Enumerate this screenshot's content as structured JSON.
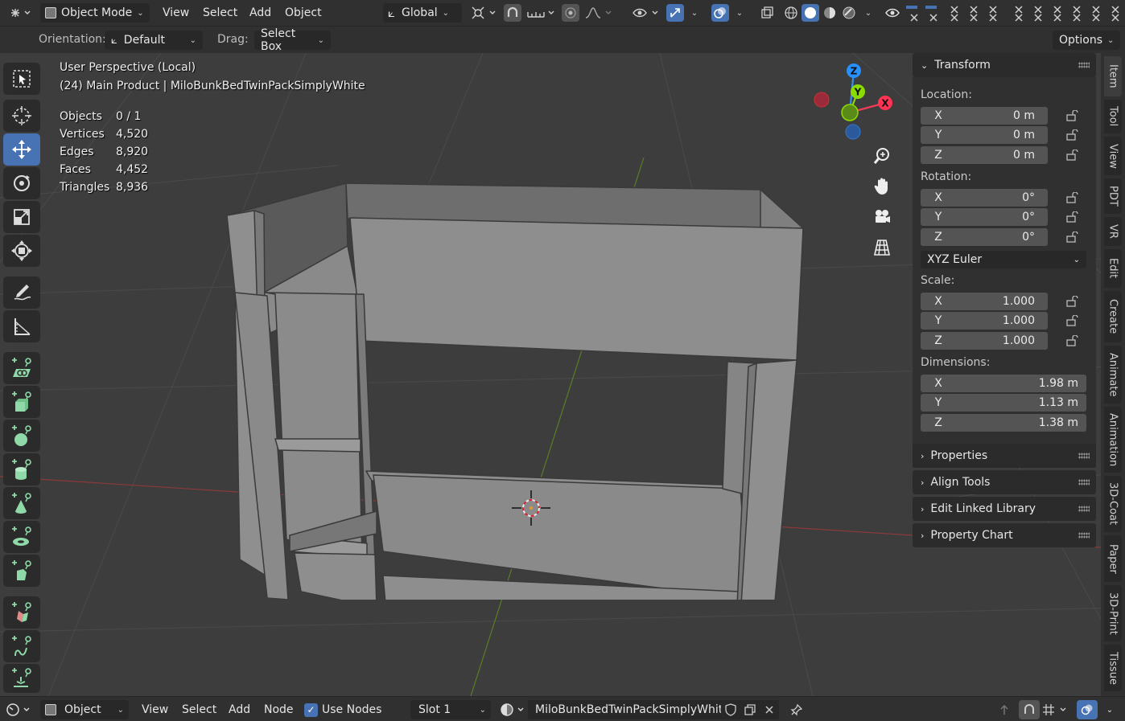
{
  "header": {
    "mode": "Object Mode",
    "menus": [
      "View",
      "Select",
      "Add",
      "Object"
    ],
    "transform_orientation": "Global",
    "icons": [
      "editor-type-icon",
      "object-mode-icon",
      "transform-orientation-icon",
      "pivot-icon",
      "snap-icon",
      "snap-increment-icon",
      "proportional-edit-icon",
      "falloff-icon",
      "visibility-icon",
      "gizmo-icon",
      "overlay-icon",
      "xray-icon",
      "wireframe-shading-icon",
      "solid-shading-icon",
      "material-shading-icon",
      "rendered-shading-icon",
      "eye-icon"
    ]
  },
  "tool_settings": {
    "orientation_label": "Orientation:",
    "orientation_value": "Default",
    "drag_label": "Drag:",
    "drag_value": "Select Box",
    "options_label": "Options"
  },
  "viewport": {
    "perspective": "User Perspective (Local)",
    "collection_info": "(24) Main Product | MiloBunkBedTwinPackSimplyWhite",
    "stats": [
      {
        "key": "Objects",
        "value": "0 / 1"
      },
      {
        "key": "Vertices",
        "value": "4,520"
      },
      {
        "key": "Edges",
        "value": "8,920"
      },
      {
        "key": "Faces",
        "value": "4,452"
      },
      {
        "key": "Triangles",
        "value": "8,936"
      }
    ],
    "gizmo_axes": {
      "x": "X",
      "y": "Y",
      "z": "Z"
    }
  },
  "colors": {
    "accent": "#4772b3",
    "axis_x": "#ff3352",
    "axis_y": "#8bdc00",
    "axis_z": "#2890ff",
    "background": "#3d3d3d"
  },
  "sidebar": {
    "transform_title": "Transform",
    "location_label": "Location:",
    "location": [
      {
        "axis": "X",
        "value": "0 m"
      },
      {
        "axis": "Y",
        "value": "0 m"
      },
      {
        "axis": "Z",
        "value": "0 m"
      }
    ],
    "rotation_label": "Rotation:",
    "rotation": [
      {
        "axis": "X",
        "value": "0°"
      },
      {
        "axis": "Y",
        "value": "0°"
      },
      {
        "axis": "Z",
        "value": "0°"
      }
    ],
    "rotation_mode": "XYZ Euler",
    "scale_label": "Scale:",
    "scale": [
      {
        "axis": "X",
        "value": "1.000"
      },
      {
        "axis": "Y",
        "value": "1.000"
      },
      {
        "axis": "Z",
        "value": "1.000"
      }
    ],
    "dimensions_label": "Dimensions:",
    "dimensions": [
      {
        "axis": "X",
        "value": "1.98 m"
      },
      {
        "axis": "Y",
        "value": "1.13 m"
      },
      {
        "axis": "Z",
        "value": "1.38 m"
      }
    ],
    "panels": [
      "Properties",
      "Align Tools",
      "Edit Linked Library",
      "Property Chart"
    ]
  },
  "side_tabs": [
    "Item",
    "Tool",
    "View",
    "PDT",
    "VR",
    "Edit",
    "Create",
    "Animate",
    "Animation",
    "3D-Coat",
    "Paper",
    "3D-Print",
    "Tissue"
  ],
  "footer": {
    "object_mode": "Object",
    "menus": [
      "View",
      "Select",
      "Add",
      "Node"
    ],
    "use_nodes_label": "Use Nodes",
    "use_nodes_checked": true,
    "slot": "Slot 1",
    "material_name": "MiloBunkBedTwinPackSimplyWhite"
  }
}
